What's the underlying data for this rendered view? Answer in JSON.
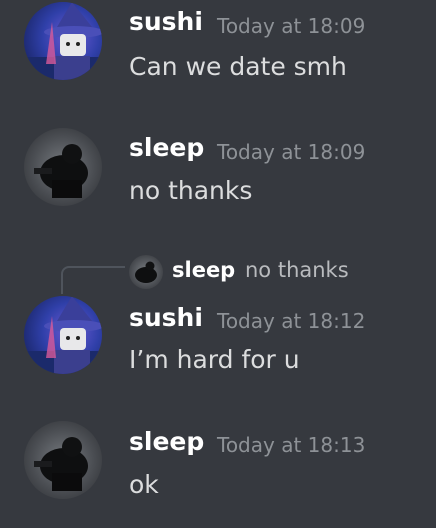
{
  "messages": [
    {
      "author": "sushi",
      "timestamp": "Today at 18:09",
      "text": "Can we date smh",
      "avatar": "wizard-avatar"
    },
    {
      "author": "sleep",
      "timestamp": "Today at 18:09",
      "text": "no thanks",
      "avatar": "dark-figure-avatar"
    },
    {
      "author": "sushi",
      "timestamp": "Today at 18:12",
      "text": "I’m hard for u",
      "avatar": "wizard-avatar",
      "reply": {
        "author": "sleep",
        "text": "no thanks"
      }
    },
    {
      "author": "sleep",
      "timestamp": "Today at 18:13",
      "text": "ok",
      "avatar": "dark-figure-avatar"
    }
  ],
  "colors": {
    "background": "#36393f",
    "author": "#ffffff",
    "timestamp": "#8e9297",
    "message": "#dcddde",
    "reply_text": "#b9bbbe"
  }
}
